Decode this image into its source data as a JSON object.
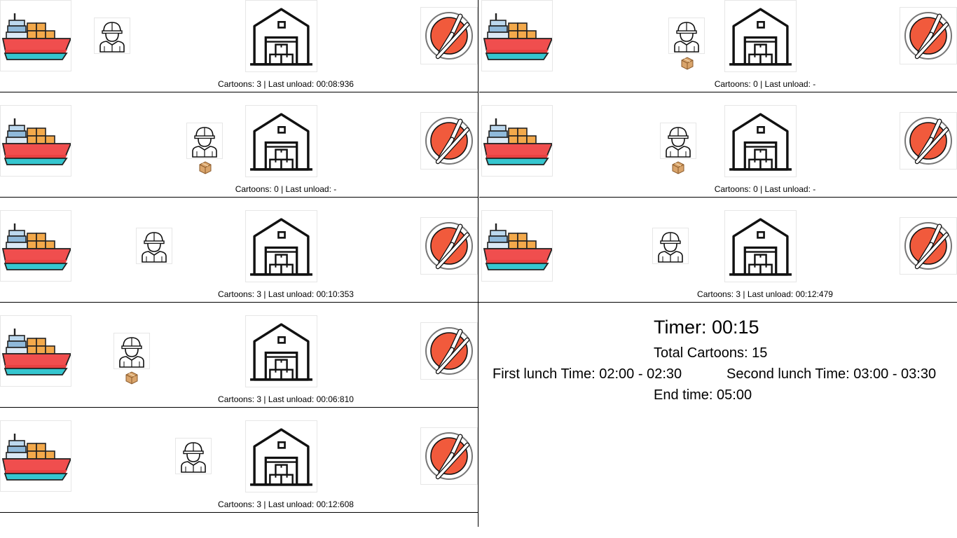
{
  "lanes": [
    {
      "status": "Cartoons: 3 | Last unload: 00:08:936",
      "carrying": false
    },
    {
      "status": "Cartoons: 0 | Last unload: -",
      "carrying": true
    },
    {
      "status": "Cartoons: 0 | Last unload: -",
      "carrying": true
    },
    {
      "status": "Cartoons: 0 | Last unload: -",
      "carrying": true
    },
    {
      "status": "Cartoons: 3 | Last unload: 00:10:353",
      "carrying": false
    },
    {
      "status": "Cartoons: 3 | Last unload: 00:12:479",
      "carrying": false
    },
    {
      "status": "Cartoons: 3 | Last unload: 00:06:810",
      "carrying": true
    },
    {
      "status": "Cartoons: 3 | Last unload: 00:12:608",
      "carrying": false
    }
  ],
  "summary": {
    "timer": "Timer: 00:15",
    "total": "Total Cartoons: 15",
    "first_lunch": "First lunch Time: 02:00 - 02:30",
    "second_lunch": "Second lunch Time: 03:00 - 03:30",
    "end_time": "End time: 05:00"
  },
  "icons": {
    "ship": "cargo-ship-icon",
    "worker": "worker-icon",
    "warehouse": "warehouse-icon",
    "food": "lunch-plate-icon",
    "box": "cardboard-box-icon"
  },
  "colors": {
    "ship_hull": "#f04e4e",
    "ship_waterline": "#35c6cf",
    "cargo": "#f3a94b",
    "plate": "#f15a3c",
    "box": "#d9a46b"
  }
}
